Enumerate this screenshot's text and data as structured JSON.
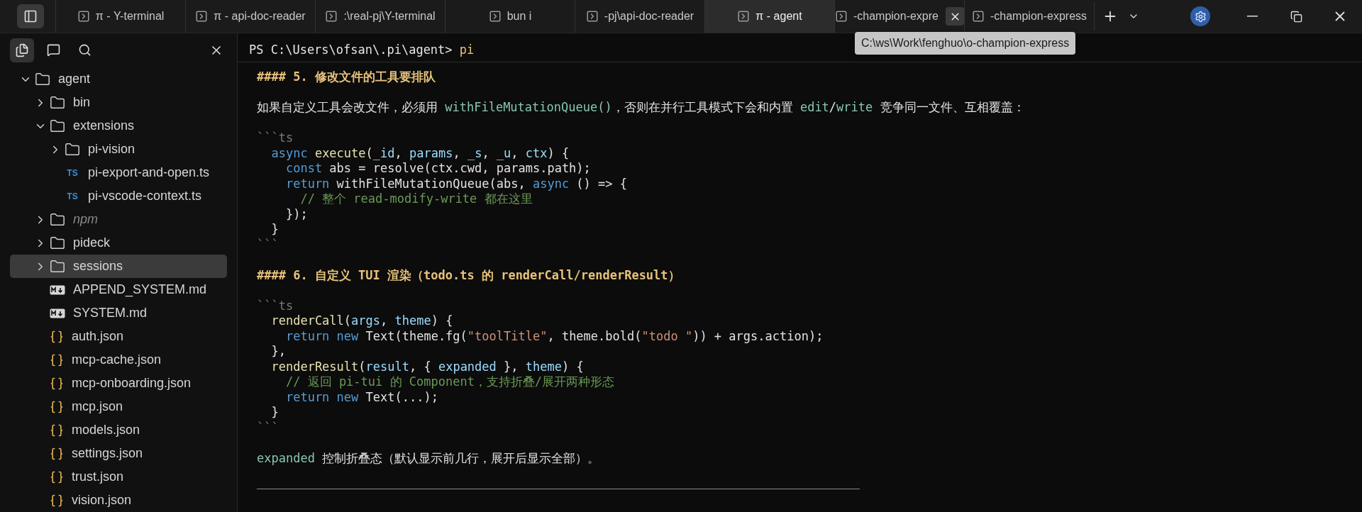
{
  "tabs": [
    {
      "title": "π - Y-terminal",
      "selected": false,
      "hovered": false
    },
    {
      "title": "π - api-doc-reader",
      "selected": false,
      "hovered": false
    },
    {
      "title": ":\\real-pj\\Y-terminal",
      "selected": false,
      "hovered": false
    },
    {
      "title": "bun i",
      "selected": false,
      "hovered": false
    },
    {
      "title": "-pj\\api-doc-reader",
      "selected": false,
      "hovered": false
    },
    {
      "title": "π - agent",
      "selected": true,
      "hovered": false
    },
    {
      "title": "-champion-expre",
      "selected": false,
      "hovered": true
    },
    {
      "title": "-champion-express",
      "selected": false,
      "hovered": false
    }
  ],
  "tooltip": {
    "text": "C:\\ws\\Work\\fenghuo\\o-champion-express"
  },
  "sidebar": {
    "tree": [
      {
        "label": "agent",
        "kind": "folder",
        "expanded": true,
        "selected": false,
        "ignored": false,
        "children": [
          {
            "label": "bin",
            "kind": "folder",
            "expanded": false,
            "selected": false,
            "ignored": false
          },
          {
            "label": "extensions",
            "kind": "folder",
            "expanded": true,
            "selected": false,
            "ignored": false,
            "children": [
              {
                "label": "pi-vision",
                "kind": "folder",
                "expanded": false,
                "selected": false,
                "ignored": false
              },
              {
                "label": "pi-export-and-open.ts",
                "kind": "ts",
                "icon_text": "TS",
                "selected": false,
                "ignored": false
              },
              {
                "label": "pi-vscode-context.ts",
                "kind": "ts",
                "icon_text": "TS",
                "selected": false,
                "ignored": false
              }
            ]
          },
          {
            "label": "npm",
            "kind": "folder",
            "expanded": false,
            "selected": false,
            "ignored": true
          },
          {
            "label": "pideck",
            "kind": "folder",
            "expanded": false,
            "selected": false,
            "ignored": false
          },
          {
            "label": "sessions",
            "kind": "folder",
            "expanded": false,
            "selected": true,
            "ignored": false
          },
          {
            "label": "APPEND_SYSTEM.md",
            "kind": "md",
            "selected": false,
            "ignored": false
          },
          {
            "label": "SYSTEM.md",
            "kind": "md",
            "selected": false,
            "ignored": false
          },
          {
            "label": "auth.json",
            "kind": "json",
            "selected": false,
            "ignored": false
          },
          {
            "label": "mcp-cache.json",
            "kind": "json",
            "selected": false,
            "ignored": false
          },
          {
            "label": "mcp-onboarding.json",
            "kind": "json",
            "selected": false,
            "ignored": false
          },
          {
            "label": "mcp.json",
            "kind": "json",
            "selected": false,
            "ignored": false
          },
          {
            "label": "models.json",
            "kind": "json",
            "selected": false,
            "ignored": false
          },
          {
            "label": "settings.json",
            "kind": "json",
            "selected": false,
            "ignored": false
          },
          {
            "label": "trust.json",
            "kind": "json",
            "selected": false,
            "ignored": false
          },
          {
            "label": "vision.json",
            "kind": "json",
            "selected": false,
            "ignored": false
          }
        ]
      }
    ]
  },
  "terminal": {
    "prompt": "PS C:\\Users\\ofsan\\.pi\\agent>",
    "command": "pi",
    "blocks": [
      {
        "kind": "heading",
        "text": "#### 5. 修改文件的工具要排队"
      },
      {
        "kind": "paragraph",
        "segments": [
          {
            "kind": "plain",
            "text": "如果自定义工具会改文件，必须用 "
          },
          {
            "kind": "code",
            "text": "withFileMutationQueue()"
          },
          {
            "kind": "plain",
            "text": "，否则在并行工具模式下会和内置 "
          },
          {
            "kind": "code",
            "text": "edit"
          },
          {
            "kind": "plain",
            "text": "/"
          },
          {
            "kind": "code",
            "text": "write"
          },
          {
            "kind": "plain",
            "text": " 竞争同一文件、互相覆盖："
          }
        ]
      },
      {
        "kind": "code",
        "open": "```ts",
        "close": "```",
        "lines": [
          [
            {
              "kind": "keyword",
              "text": "  async"
            },
            {
              "kind": "function",
              "text": " execute"
            },
            {
              "kind": "plain",
              "text": "("
            },
            {
              "kind": "variable",
              "text": "_id"
            },
            {
              "kind": "plain",
              "text": ", "
            },
            {
              "kind": "variable",
              "text": "params"
            },
            {
              "kind": "plain",
              "text": ", "
            },
            {
              "kind": "variable",
              "text": "_s"
            },
            {
              "kind": "plain",
              "text": ", "
            },
            {
              "kind": "variable",
              "text": "_u"
            },
            {
              "kind": "plain",
              "text": ", "
            },
            {
              "kind": "variable",
              "text": "ctx"
            },
            {
              "kind": "plain",
              "text": ") {"
            }
          ],
          [
            {
              "kind": "keyword",
              "text": "    const"
            },
            {
              "kind": "plain",
              "text": " abs = resolve(ctx.cwd, params.path);"
            }
          ],
          [
            {
              "kind": "keyword",
              "text": "    return"
            },
            {
              "kind": "plain",
              "text": " withFileMutationQueue(abs, "
            },
            {
              "kind": "keyword",
              "text": "async"
            },
            {
              "kind": "plain",
              "text": " () => {"
            }
          ],
          [
            {
              "kind": "comment",
              "text": "      // 整个 read-modify-write 都在这里"
            }
          ],
          [
            {
              "kind": "plain",
              "text": "    });"
            }
          ],
          [
            {
              "kind": "plain",
              "text": "  }"
            }
          ]
        ]
      },
      {
        "kind": "heading",
        "text": "#### 6. 自定义 TUI 渲染（todo.ts 的 renderCall/renderResult）"
      },
      {
        "kind": "code",
        "open": "```ts",
        "close": "```",
        "lines": [
          [
            {
              "kind": "function",
              "text": "  renderCall"
            },
            {
              "kind": "plain",
              "text": "("
            },
            {
              "kind": "variable",
              "text": "args"
            },
            {
              "kind": "plain",
              "text": ", "
            },
            {
              "kind": "variable",
              "text": "theme"
            },
            {
              "kind": "plain",
              "text": ") {"
            }
          ],
          [
            {
              "kind": "keyword",
              "text": "    return new"
            },
            {
              "kind": "plain",
              "text": " Text(theme.fg("
            },
            {
              "kind": "string",
              "text": "\"toolTitle\""
            },
            {
              "kind": "plain",
              "text": ", theme.bold("
            },
            {
              "kind": "string",
              "text": "\"todo \""
            },
            {
              "kind": "plain",
              "text": ")) + args.action);"
            }
          ],
          [
            {
              "kind": "plain",
              "text": "  },"
            }
          ],
          [
            {
              "kind": "function",
              "text": "  renderResult"
            },
            {
              "kind": "plain",
              "text": "("
            },
            {
              "kind": "variable",
              "text": "result"
            },
            {
              "kind": "plain",
              "text": ", { "
            },
            {
              "kind": "variable",
              "text": "expanded"
            },
            {
              "kind": "plain",
              "text": " }, "
            },
            {
              "kind": "variable",
              "text": "theme"
            },
            {
              "kind": "plain",
              "text": ") {"
            }
          ],
          [
            {
              "kind": "comment",
              "text": "    // 返回 pi-tui 的 Component，支持折叠/展开两种形态"
            }
          ],
          [
            {
              "kind": "keyword",
              "text": "    return new"
            },
            {
              "kind": "plain",
              "text": " Text(...);"
            }
          ],
          [
            {
              "kind": "plain",
              "text": "  }"
            }
          ]
        ]
      },
      {
        "kind": "paragraph",
        "segments": [
          {
            "kind": "code",
            "text": "expanded"
          },
          {
            "kind": "plain",
            "text": " 控制折叠态（默认显示前几行，展开后显示全部）。"
          }
        ]
      },
      {
        "kind": "rule"
      }
    ]
  }
}
